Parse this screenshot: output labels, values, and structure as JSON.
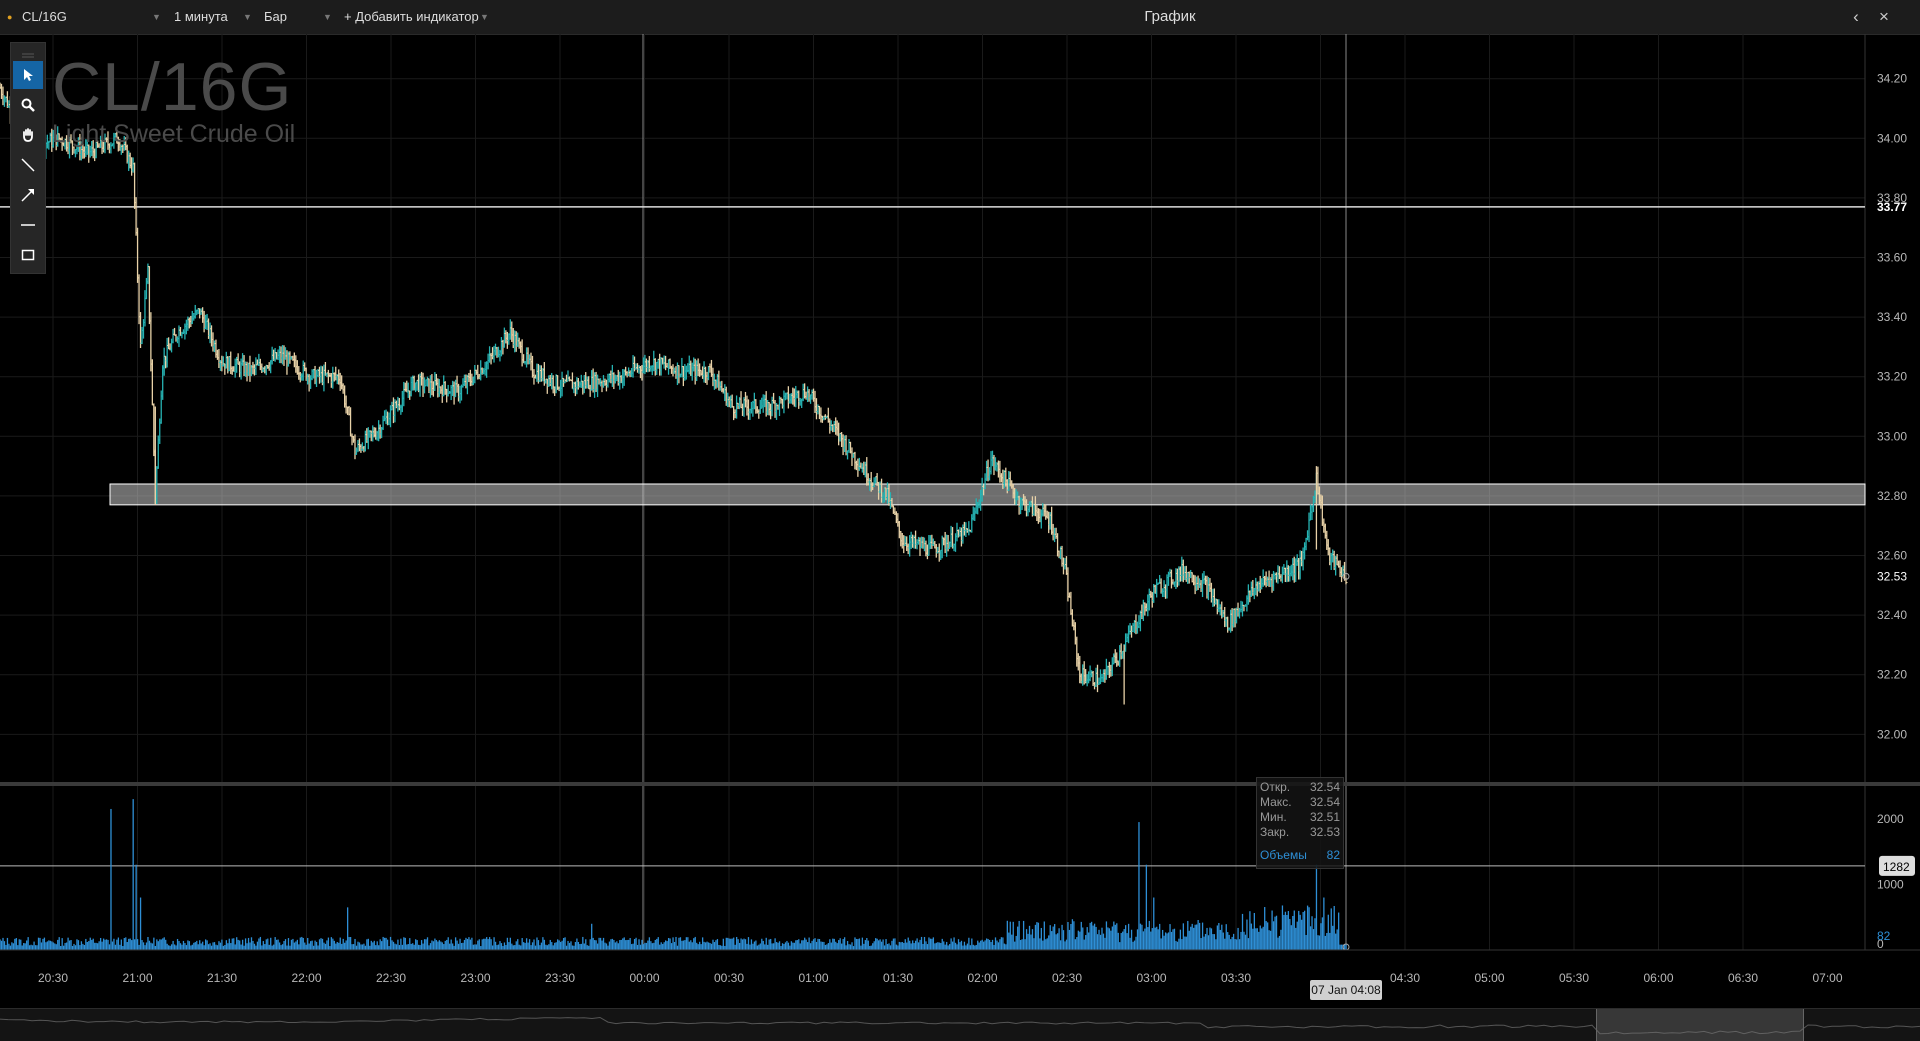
{
  "header": {
    "symbol": "CL/16G",
    "interval": "1 минута",
    "chart_type": "Бар",
    "add_indicator": "+ Добавить индикатор",
    "title": "График",
    "back_icon": "chevron-left-icon",
    "close_icon": "close-icon"
  },
  "toolbar": {
    "tools": [
      "cursor-icon",
      "zoom-icon",
      "pan-icon",
      "line-icon",
      "arrow-icon",
      "horizontal-line-icon",
      "rectangle-icon"
    ],
    "active": "cursor-icon"
  },
  "watermark": {
    "symbol": "CL/16G",
    "name": "Light Sweet Crude Oil"
  },
  "ohlc_tooltip": {
    "open_label": "Откр.",
    "open_value": "32.54",
    "high_label": "Макс.",
    "high_value": "32.54",
    "low_label": "Мин.",
    "low_value": "32.51",
    "close_label": "Закр.",
    "close_value": "32.53",
    "volume_label": "Объемы",
    "volume_value": "82"
  },
  "crosshair_time": "07 Jan 04:08",
  "colors": {
    "up": "#26b3b3",
    "down": "#e8d2a8",
    "volume": "#2e8fd6",
    "grid": "#1a1a1a",
    "background": "#000000"
  },
  "chart_data": [
    {
      "type": "candlestick",
      "title": "CL/16G",
      "subtitle": "Light Sweet Crude Oil",
      "xlabel": "",
      "ylabel": "",
      "time_ticks": [
        "20:30",
        "21:00",
        "21:30",
        "22:00",
        "22:30",
        "23:00",
        "23:30",
        "00:00",
        "00:30",
        "01:00",
        "01:30",
        "02:00",
        "02:30",
        "03:00",
        "03:30",
        "04:30",
        "05:00",
        "05:30",
        "06:00",
        "06:30",
        "07:00"
      ],
      "y_ticks": [
        "32.00",
        "32.20",
        "32.40",
        "32.60",
        "32.80",
        "33.00",
        "33.20",
        "33.40",
        "33.60",
        "33.80",
        "34.00",
        "34.20"
      ],
      "ylim": [
        31.84,
        34.35
      ],
      "last_price": "32.53",
      "horizontal_line_level": "33.77",
      "horizontal_line_value": 33.77,
      "zone_top": 32.84,
      "zone_bottom": 32.77,
      "grid": true,
      "price_path": [
        [
          0,
          34.17
        ],
        [
          20,
          33.97
        ],
        [
          40,
          34.0
        ],
        [
          60,
          33.95
        ],
        [
          80,
          34.0
        ],
        [
          90,
          33.9
        ],
        [
          95,
          33.3
        ],
        [
          100,
          33.55
        ],
        [
          105,
          32.8
        ],
        [
          110,
          33.25
        ],
        [
          120,
          33.35
        ],
        [
          135,
          33.42
        ],
        [
          150,
          33.25
        ],
        [
          170,
          33.22
        ],
        [
          190,
          33.27
        ],
        [
          210,
          33.2
        ],
        [
          230,
          33.2
        ],
        [
          240,
          32.95
        ],
        [
          255,
          33.02
        ],
        [
          280,
          33.18
        ],
        [
          310,
          33.15
        ],
        [
          330,
          33.25
        ],
        [
          345,
          33.35
        ],
        [
          360,
          33.22
        ],
        [
          380,
          33.17
        ],
        [
          400,
          33.18
        ],
        [
          420,
          33.2
        ],
        [
          440,
          33.25
        ],
        [
          460,
          33.22
        ],
        [
          480,
          33.22
        ],
        [
          495,
          33.1
        ],
        [
          520,
          33.1
        ],
        [
          545,
          33.15
        ],
        [
          560,
          33.05
        ],
        [
          590,
          32.85
        ],
        [
          600,
          32.8
        ],
        [
          610,
          32.65
        ],
        [
          630,
          32.62
        ],
        [
          655,
          32.68
        ],
        [
          670,
          32.92
        ],
        [
          690,
          32.78
        ],
        [
          710,
          32.72
        ],
        [
          720,
          32.55
        ],
        [
          730,
          32.2
        ],
        [
          745,
          32.18
        ],
        [
          760,
          32.3
        ],
        [
          780,
          32.48
        ],
        [
          800,
          32.55
        ],
        [
          815,
          32.5
        ],
        [
          830,
          32.37
        ],
        [
          850,
          32.5
        ],
        [
          870,
          32.55
        ],
        [
          880,
          32.57
        ],
        [
          890,
          32.86
        ],
        [
          898,
          32.6
        ],
        [
          910,
          32.53
        ]
      ],
      "volume_ticks": [
        "0",
        "82",
        "1000",
        "2000"
      ],
      "volume_ylim": [
        0,
        2500
      ],
      "volume_reference_level": 1282,
      "volume_reference_label": "1282",
      "volume_last": "82",
      "volume_spikes": [
        [
          75,
          2150
        ],
        [
          90,
          2300
        ],
        [
          92,
          1300
        ],
        [
          95,
          800
        ],
        [
          235,
          650
        ],
        [
          400,
          400
        ],
        [
          770,
          1950
        ],
        [
          775,
          1300
        ],
        [
          780,
          800
        ],
        [
          840,
          550
        ],
        [
          890,
          1300
        ],
        [
          895,
          800
        ]
      ]
    }
  ]
}
